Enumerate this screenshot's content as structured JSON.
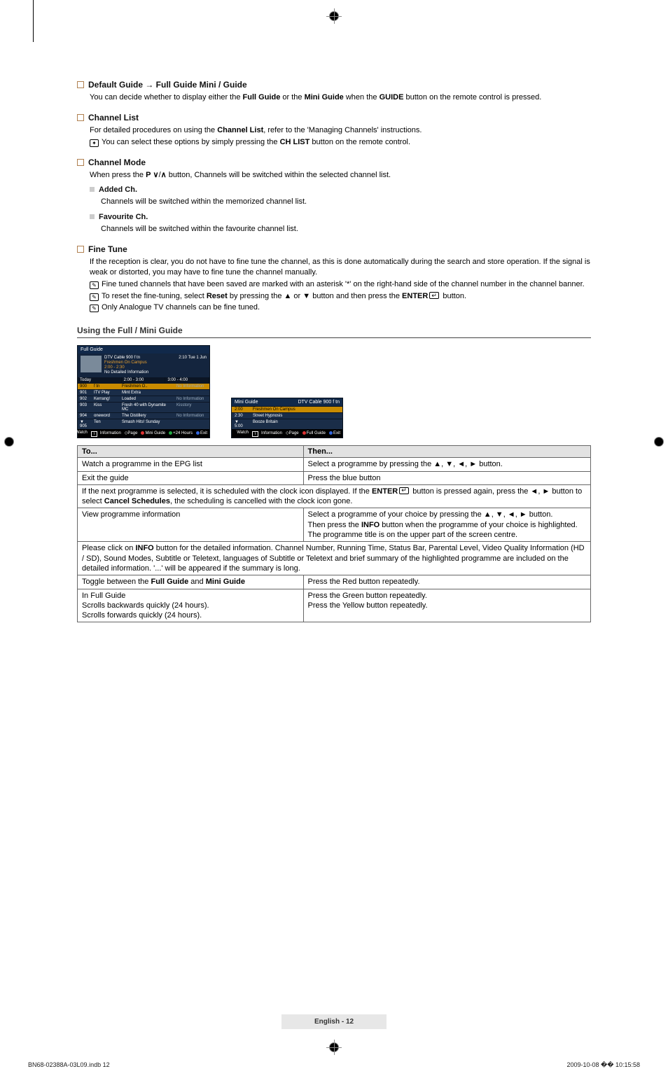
{
  "sections": {
    "default_guide": {
      "title": "Default Guide → Full Guide Mini / Guide",
      "body_pre": "You can decide whether to display either the ",
      "b1": "Full Guide",
      "mid1": " or the ",
      "b2": "Mini Guide",
      "mid2": " when the ",
      "b3": "GUIDE",
      "body_post": " button on the remote control is pressed."
    },
    "channel_list": {
      "title": "Channel List",
      "body_pre": "For detailed procedures on using the ",
      "b1": "Channel List",
      "body_post": ", refer to the 'Managing Channels' instructions.",
      "note_pre": "You can select these options by simply pressing the ",
      "note_b": "CH LIST",
      "note_post": " button on the remote control."
    },
    "channel_mode": {
      "title": "Channel Mode",
      "body_pre": "When press the ",
      "b1": "P",
      "body_post": " button, Channels will be switched within the selected channel list.",
      "added_title": "Added Ch.",
      "added_body": "Channels will be switched within the memorized channel list.",
      "fav_title": "Favourite Ch.",
      "fav_body": "Channels will be switched within the favourite channel list."
    },
    "fine_tune": {
      "title": "Fine Tune",
      "body": "If the reception is clear, you do not have to fine tune the channel, as this is done automatically during the search and store operation. If the signal is weak or distorted, you may have to fine tune the channel manually.",
      "n1": "Fine tuned channels that have been saved are marked with an asterisk '*' on the right-hand side of the channel number in the channel banner.",
      "n2_pre": "To reset the fine-tuning, select ",
      "n2_b1": "Reset",
      "n2_mid": " by pressing the ▲ or ▼ button and then press the ",
      "n2_b2": "ENTER",
      "n2_post": " button.",
      "n3": "Only Analogue TV channels can be fine tuned."
    }
  },
  "using_title": "Using the Full / Mini Guide",
  "full_guide": {
    "title": "Full Guide",
    "channel": "DTV Cable 900 f tn",
    "datetime": "2:10 Tue 1 Jun",
    "prog": "Freshmen On Campus",
    "time": "2:00 - 2:30",
    "detail": "No Detailed Information",
    "today": "Today",
    "slot1": "2:00 - 3:00",
    "slot2": "3:00 - 4:00",
    "rows": [
      {
        "n": "900",
        "ch": "f tn",
        "p": "Freshmen O..",
        "p2": "Street Hypn..",
        "p3": "No Information"
      },
      {
        "n": "901",
        "ch": "ITV Play",
        "p": "Mint Extra",
        "p2": "",
        "p3": ""
      },
      {
        "n": "902",
        "ch": "Kerrang!",
        "p": "Loaded",
        "p2": "",
        "p3": "No Information"
      },
      {
        "n": "903",
        "ch": "Kiss",
        "p": "Fresh 40 with Dynamite MC",
        "p2": "",
        "p3": "Kisstory"
      },
      {
        "n": "904",
        "ch": "oneword",
        "p": "The Distillery",
        "p2": "",
        "p3": "No Information"
      },
      {
        "n": "▼ 905",
        "ch": "Ten",
        "p": "Smash Hits! Sunday",
        "p2": "",
        "p3": ""
      }
    ],
    "foot": {
      "watch": "Watch",
      "info": "Information",
      "page": "Page",
      "mini": "Mini Guide",
      "hours": "+24 Hours",
      "exit": "Exit"
    }
  },
  "mini_guide": {
    "title": "Mini Guide",
    "channel": "DTV Cable 900 f tn",
    "rows": [
      {
        "t": "2:00",
        "p": "Freshmen On Campus"
      },
      {
        "t": "2:30",
        "p": "Street Hypnosis"
      },
      {
        "t": "▼ 5:00",
        "p": "Booze Britain"
      }
    ],
    "foot": {
      "watch": "Watch",
      "info": "Information",
      "page": "Page",
      "full": "Full Guide",
      "exit": "Exit"
    }
  },
  "table": {
    "h1": "To...",
    "h2": "Then...",
    "r1a": "Watch a programme in the EPG list",
    "r1b": "Select a programme by pressing the ▲, ▼, ◄, ► button.",
    "r2a": "Exit the guide",
    "r2b": "Press the blue button",
    "span1_pre": "If the next programme is selected, it is scheduled with the clock icon displayed. If the ",
    "span1_b1": "ENTER",
    "span1_mid": " button is pressed again, press the ◄, ► button to select ",
    "span1_b2": "Cancel Schedules",
    "span1_post": ", the scheduling is cancelled with the clock icon gone.",
    "r3a": "View programme information",
    "r3b_l1": "Select a programme of your choice by pressing the ▲, ▼, ◄, ► button.",
    "r3b_l2_pre": "Then press the ",
    "r3b_l2_b": "INFO",
    "r3b_l2_post": " button when the programme of your choice is highlighted.",
    "r3b_l3": "The programme title is on the upper part of the screen centre.",
    "span2_pre": "Please click on ",
    "span2_b": "INFO",
    "span2_post": " button for the detailed information. Channel Number, Running Time, Status Bar, Parental Level, Video Quality Information (HD / SD), Sound Modes, Subtitle or Teletext, languages of Subtitle or Teletext and brief summary of the highlighted programme are included on the detailed information. '...' will be appeared if the summary is long.",
    "r4a_pre": "Toggle between the ",
    "r4a_b1": "Full Guide",
    "r4a_mid": " and ",
    "r4a_b2": "Mini Guide",
    "r4b": "Press the Red button repeatedly.",
    "r5a1": "In Full Guide",
    "r5a2": "Scrolls backwards quickly (24 hours).",
    "r5a3": "Scrolls forwards quickly (24 hours).",
    "r5b1": "",
    "r5b2": "Press the Green button repeatedly.",
    "r5b3": "Press the Yellow button repeatedly."
  },
  "footer": "English - 12",
  "bottom_left": "BN68-02388A-03L09.indb   12",
  "bottom_right": "2009-10-08   �� 10:15:58"
}
